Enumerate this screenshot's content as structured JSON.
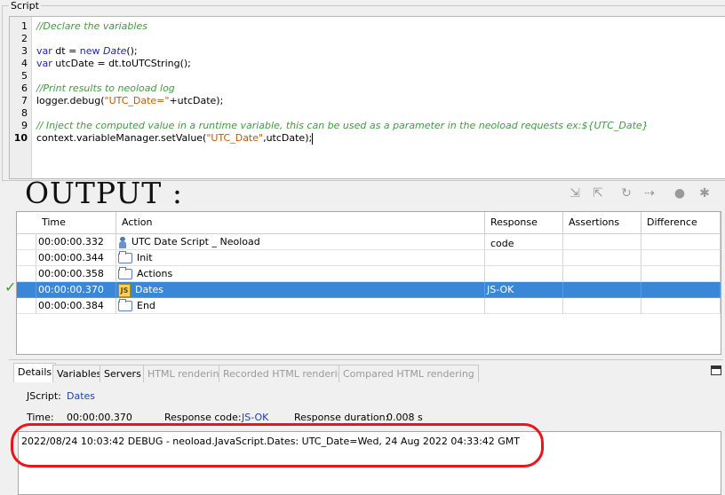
{
  "script": {
    "legend": "Script",
    "line_numbers": [
      "1",
      "2",
      "3",
      "4",
      "5",
      "6",
      "7",
      "8",
      "9",
      "10"
    ],
    "lines": [
      {
        "parts": [
          {
            "cls": "cm",
            "text": "//Declare the variables"
          }
        ]
      },
      {
        "parts": []
      },
      {
        "parts": [
          {
            "cls": "kw",
            "text": "var"
          },
          {
            "cls": "",
            "text": " dt = "
          },
          {
            "cls": "kw",
            "text": "new"
          },
          {
            "cls": "",
            "text": " "
          },
          {
            "cls": "ty",
            "text": "Date"
          },
          {
            "cls": "",
            "text": "();"
          }
        ]
      },
      {
        "parts": [
          {
            "cls": "kw",
            "text": "var"
          },
          {
            "cls": "",
            "text": " utcDate = dt.toUTCString();"
          }
        ]
      },
      {
        "parts": []
      },
      {
        "parts": [
          {
            "cls": "cm",
            "text": "//Print results to neoload log"
          }
        ]
      },
      {
        "parts": [
          {
            "cls": "",
            "text": "logger.debug("
          },
          {
            "cls": "st",
            "text": "\"UTC_Date=\""
          },
          {
            "cls": "",
            "text": "+utcDate);"
          }
        ]
      },
      {
        "parts": []
      },
      {
        "parts": [
          {
            "cls": "cm",
            "text": "// Inject the computed value in a runtime variable, this can be used as a parameter in the neoload requests ex:${UTC_Date}"
          }
        ]
      },
      {
        "parts": [
          {
            "cls": "",
            "text": "context.variableManager.setValue("
          },
          {
            "cls": "st",
            "text": "\"UTC_Date\""
          },
          {
            "cls": "",
            "text": ",utcDate);"
          }
        ]
      }
    ]
  },
  "output": {
    "title": "OUTPUT :",
    "toolbar_icons": [
      "step-into-icon",
      "step-back-icon",
      "redo-icon",
      "forward-icon",
      "stop-icon",
      "settings-icon"
    ]
  },
  "table": {
    "columns": [
      "Time",
      "Action",
      "Response code",
      "Assertions",
      "Difference"
    ],
    "rows": [
      {
        "time": "00:00:00.332",
        "action": "UTC Date Script _ Neoload",
        "icon": "user-icon",
        "response": "",
        "selected": false
      },
      {
        "time": "00:00:00.344",
        "action": "Init",
        "icon": "folder-icon",
        "response": "",
        "selected": false
      },
      {
        "time": "00:00:00.358",
        "action": "Actions",
        "icon": "folder-icon",
        "response": "",
        "selected": false
      },
      {
        "time": "00:00:00.370",
        "action": "Dates",
        "icon": "javascript-icon",
        "response": "JS-OK",
        "selected": true
      },
      {
        "time": "00:00:00.384",
        "action": "End",
        "icon": "folder-icon",
        "response": "",
        "selected": false
      }
    ],
    "status_mark": "✓"
  },
  "details": {
    "tabs": [
      {
        "label": "Details",
        "state": "active"
      },
      {
        "label": "Variables",
        "state": "normal"
      },
      {
        "label": "Servers",
        "state": "normal"
      },
      {
        "label": "HTML rendering",
        "state": "disabled"
      },
      {
        "label": "Recorded HTML rendering",
        "state": "disabled"
      },
      {
        "label": "Compared HTML rendering",
        "state": "disabled"
      }
    ],
    "jscript_label": "JScript:",
    "jscript_value": "Dates",
    "time_label": "Time:",
    "time_value": "00:00:00.370",
    "response_code_label": "Response code:",
    "response_code_value": "JS-OK",
    "response_duration_label": "Response duration:",
    "response_duration_value": "0.008 s",
    "log": "2022/08/24 10:03:42 DEBUG - neoload.JavaScript.Dates: UTC_Date=Wed, 24 Aug 2022 04:33:42 GMT"
  },
  "colors": {
    "annotation": "#e8151b",
    "selection": "#3a87d8",
    "comment": "#3f9b3f",
    "keyword": "#1c1cd4",
    "string": "#c05a00"
  }
}
